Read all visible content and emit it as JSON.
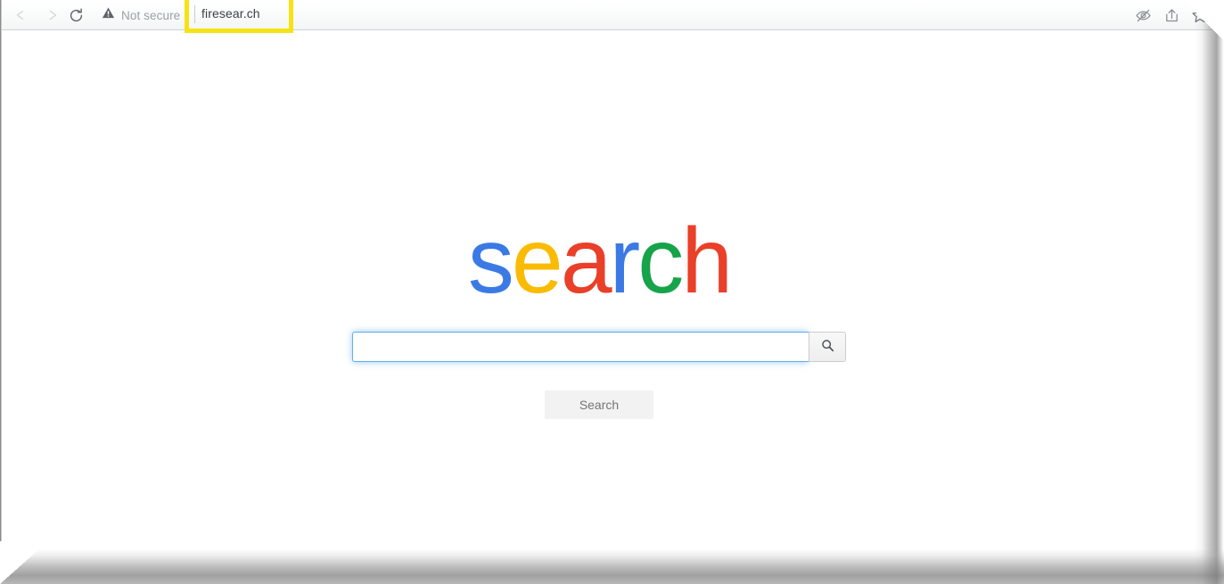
{
  "browser": {
    "nav": {
      "back_icon": "arrow-left-icon",
      "forward_icon": "arrow-right-icon",
      "reload_icon": "reload-icon"
    },
    "security": {
      "icon": "warning-triangle-icon",
      "label": "Not secure"
    },
    "url": "firesear.ch",
    "url_highlight_color": "#f7e213",
    "toolbar_icons": [
      {
        "name": "eye-slash-icon",
        "label": ""
      },
      {
        "name": "share-icon",
        "label": ""
      },
      {
        "name": "star-icon",
        "label": ""
      }
    ]
  },
  "page": {
    "logo": {
      "text": "search",
      "letters": [
        {
          "char": "s",
          "color": "#3b7ae5"
        },
        {
          "char": "e",
          "color": "#fabb05"
        },
        {
          "char": "a",
          "color": "#ea3f28"
        },
        {
          "char": "r",
          "color": "#3b7ae5"
        },
        {
          "char": "c",
          "color": "#16a34a"
        },
        {
          "char": "h",
          "color": "#ea3f28"
        }
      ]
    },
    "search": {
      "value": "",
      "placeholder": "",
      "icon_button": "magnifier-icon",
      "submit_label": "Search"
    }
  }
}
